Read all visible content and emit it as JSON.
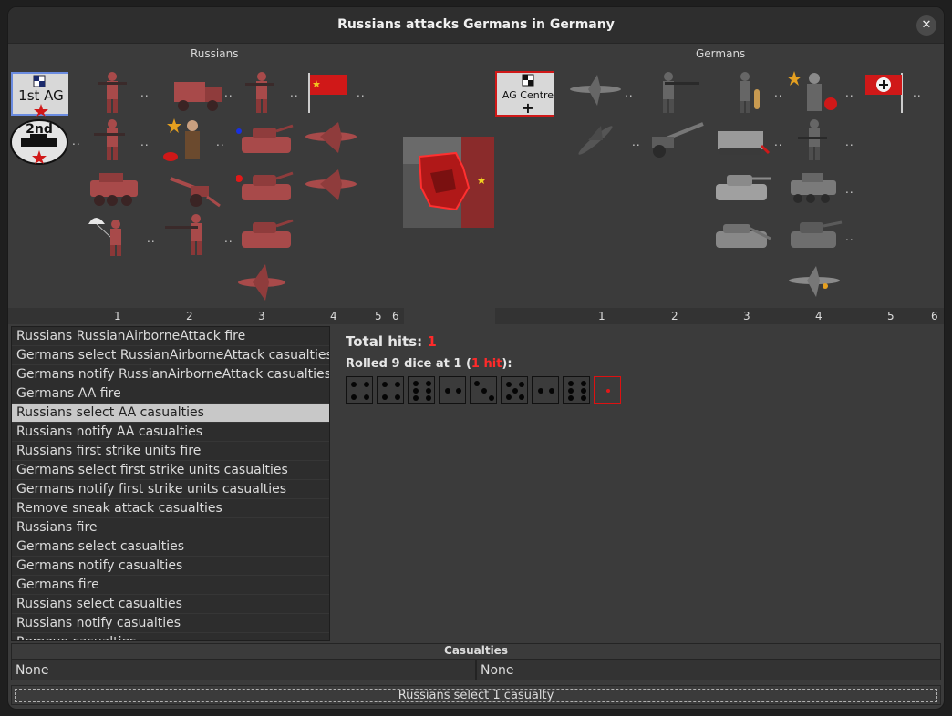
{
  "window": {
    "title": "Russians attacks Germans in Germany"
  },
  "attacker": {
    "name": "Russians",
    "markers": [
      "1st AG",
      "2nd"
    ],
    "units": {
      "col1": [
        "infantry",
        "infantry",
        "armoured car",
        "paratrooper"
      ],
      "col2": [
        "truck",
        "commissar",
        "artillery",
        "infantry"
      ],
      "col3": [
        "infantry",
        "tank",
        "tank",
        "tank",
        "fighter"
      ],
      "col4": [
        "flag",
        "bomber",
        "bomber"
      ]
    },
    "columns": [
      "1",
      "2",
      "3",
      "4",
      "5",
      "6"
    ]
  },
  "defender": {
    "name": "Germans",
    "marker": "AG Centre",
    "marker_symbol": "+",
    "columns": [
      "1",
      "2",
      "3",
      "4",
      "5",
      "6"
    ]
  },
  "more_indicator": "..",
  "history": [
    "Russians RussianAirborneAttack fire",
    "Germans select RussianAirborneAttack casualties",
    "Germans notify RussianAirborneAttack casualties",
    "Germans AA fire",
    "Russians select AA casualties",
    "Russians notify AA casualties",
    "Russians first strike units fire",
    "Germans select first strike units casualties",
    "Germans notify first strike units casualties",
    "Remove sneak attack casualties",
    "Russians fire",
    "Germans select casualties",
    "Germans notify casualties",
    "Germans fire",
    "Russians select casualties",
    "Russians notify casualties",
    "Remove casualties"
  ],
  "selected_history_index": 4,
  "dice": {
    "total_label": "Total hits:",
    "total_value": "1",
    "rolled_prefix": "Rolled 9 dice at 1 (",
    "rolled_hits": "1 hit",
    "rolled_suffix": "):",
    "values": [
      4,
      4,
      6,
      2,
      3,
      5,
      2,
      6,
      1
    ],
    "hit_die_index": 8
  },
  "casualties": {
    "title": "Casualties",
    "attacker": "None",
    "defender": "None"
  },
  "action_button": "Russians select 1 casualty",
  "colors": {
    "russian_unit": "#a84a4a",
    "german_unit": "#7a7a7a",
    "hit": "#ff2a2a"
  }
}
